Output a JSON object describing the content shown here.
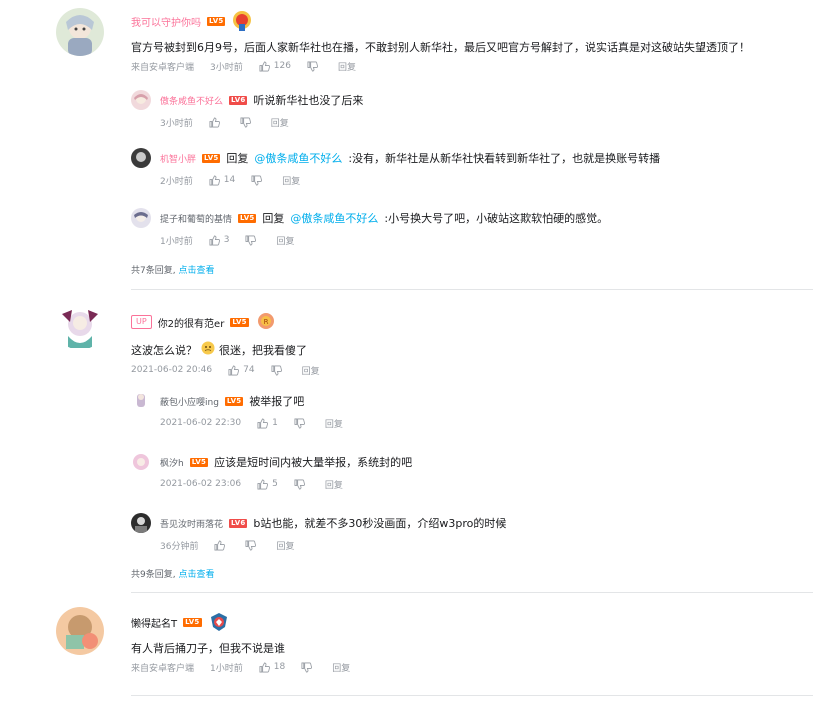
{
  "threads": [
    {
      "user": "我可以守护你吗",
      "level": "LV5",
      "text": "官方号被封到6月9号，后面人家新华社也在播，不敢封别人新华社，最后又吧官方号解封了，说实话真是对这破站失望透顶了！",
      "source": "来自安卓客户端",
      "time": "3小时前",
      "likes": "126",
      "reply_label": "回复",
      "replies": [
        {
          "user": "傲条咸鱼不好么",
          "level": "LV6",
          "text": "听说新华社也没了后来",
          "time": "3小时前",
          "likes": "",
          "reply_label": "回复"
        },
        {
          "user": "机智小胖",
          "level": "LV5",
          "prefix": "回复",
          "at": "@傲条咸鱼不好么",
          "text": ":没有，新华社是从新华社快看转到新华社了，也就是换账号转播",
          "time": "2小时前",
          "likes": "14",
          "reply_label": "回复"
        },
        {
          "user": "提子和葡萄的基情",
          "level": "LV5",
          "prefix": "回复",
          "at": "@傲条咸鱼不好么",
          "text": ":小号换大号了吧，小破站这欺软怕硬的感觉。",
          "time": "1小时前",
          "likes": "3",
          "reply_label": "回复"
        }
      ],
      "more_count": "共7条回复,",
      "more_link": "点击查看"
    },
    {
      "up_tag": "UP",
      "user": "你2的很有范er",
      "level": "LV5",
      "text_a": "这波怎么说？",
      "text_b": "很迷，把我看傻了",
      "time": "2021-06-02 20:46",
      "likes": "74",
      "reply_label": "回复",
      "replies": [
        {
          "user": "蔽包小应嘤ing",
          "level": "LV5",
          "text": "被举报了吧",
          "time": "2021-06-02 22:30",
          "likes": "1",
          "reply_label": "回复"
        },
        {
          "user": "枫汐h",
          "level": "LV5",
          "text": "应该是短时间内被大量举报，系统封的吧",
          "time": "2021-06-02 23:06",
          "likes": "5",
          "reply_label": "回复"
        },
        {
          "user": "吾见汝时雨落花",
          "level": "LV6",
          "text": "b站也能，就差不多30秒没画面，介绍w3pro的时候",
          "time": "36分钟前",
          "likes": "",
          "reply_label": "回复"
        }
      ],
      "more_count": "共9条回复,",
      "more_link": "点击查看"
    },
    {
      "user": "懒得起名T",
      "level": "LV5",
      "text": "有人背后捅刀子，但我不说是谁",
      "source": "来自安卓客户端",
      "time": "1小时前",
      "likes": "18",
      "reply_label": "回复"
    }
  ],
  "colors": {
    "accent": "#00aeec",
    "pink": "#fb7299",
    "level": "#ff6c00",
    "meta": "#9499a0"
  }
}
